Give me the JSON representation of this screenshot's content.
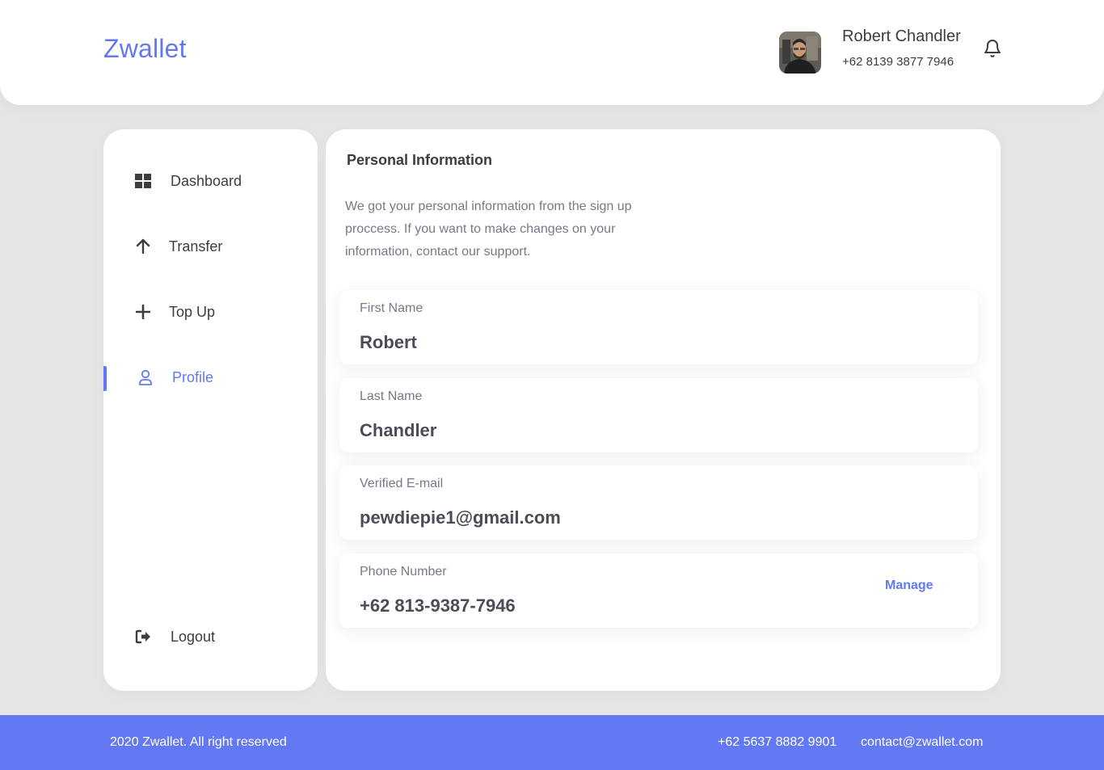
{
  "header": {
    "brand": "Zwallet",
    "user": {
      "name": "Robert Chandler",
      "phone": "+62 8139 3877 7946",
      "avatar_alt": "Robert Chandler avatar"
    },
    "bell_icon": "bell-icon"
  },
  "sidebar": {
    "items": [
      {
        "label": "Dashboard",
        "icon": "grid-icon",
        "active": false
      },
      {
        "label": "Transfer",
        "icon": "arrow-up-icon",
        "active": false
      },
      {
        "label": "Top Up",
        "icon": "plus-icon",
        "active": false
      },
      {
        "label": "Profile",
        "icon": "user-icon",
        "active": true
      }
    ],
    "logout": {
      "label": "Logout",
      "icon": "logout-icon"
    }
  },
  "main": {
    "title": "Personal Information",
    "description": "We got your personal information from the sign up proccess. If you want to make changes on your information, contact our support.",
    "fields": [
      {
        "label": "First Name",
        "value": "Robert"
      },
      {
        "label": "Last Name",
        "value": "Chandler"
      },
      {
        "label": "Verified E-mail",
        "value": "pewdiepie1@gmail.com"
      },
      {
        "label": "Phone Number",
        "value": "+62 813-9387-7946",
        "action": "Manage"
      }
    ]
  },
  "footer": {
    "copyright": "2020 Zwallet. All right reserved",
    "phone": "+62 5637 8882 9901",
    "email": "contact@zwallet.com"
  },
  "colors": {
    "accent": "#6379f4",
    "background": "#e5e5e5",
    "text": "#3a3d42",
    "muted": "#7a7886"
  }
}
